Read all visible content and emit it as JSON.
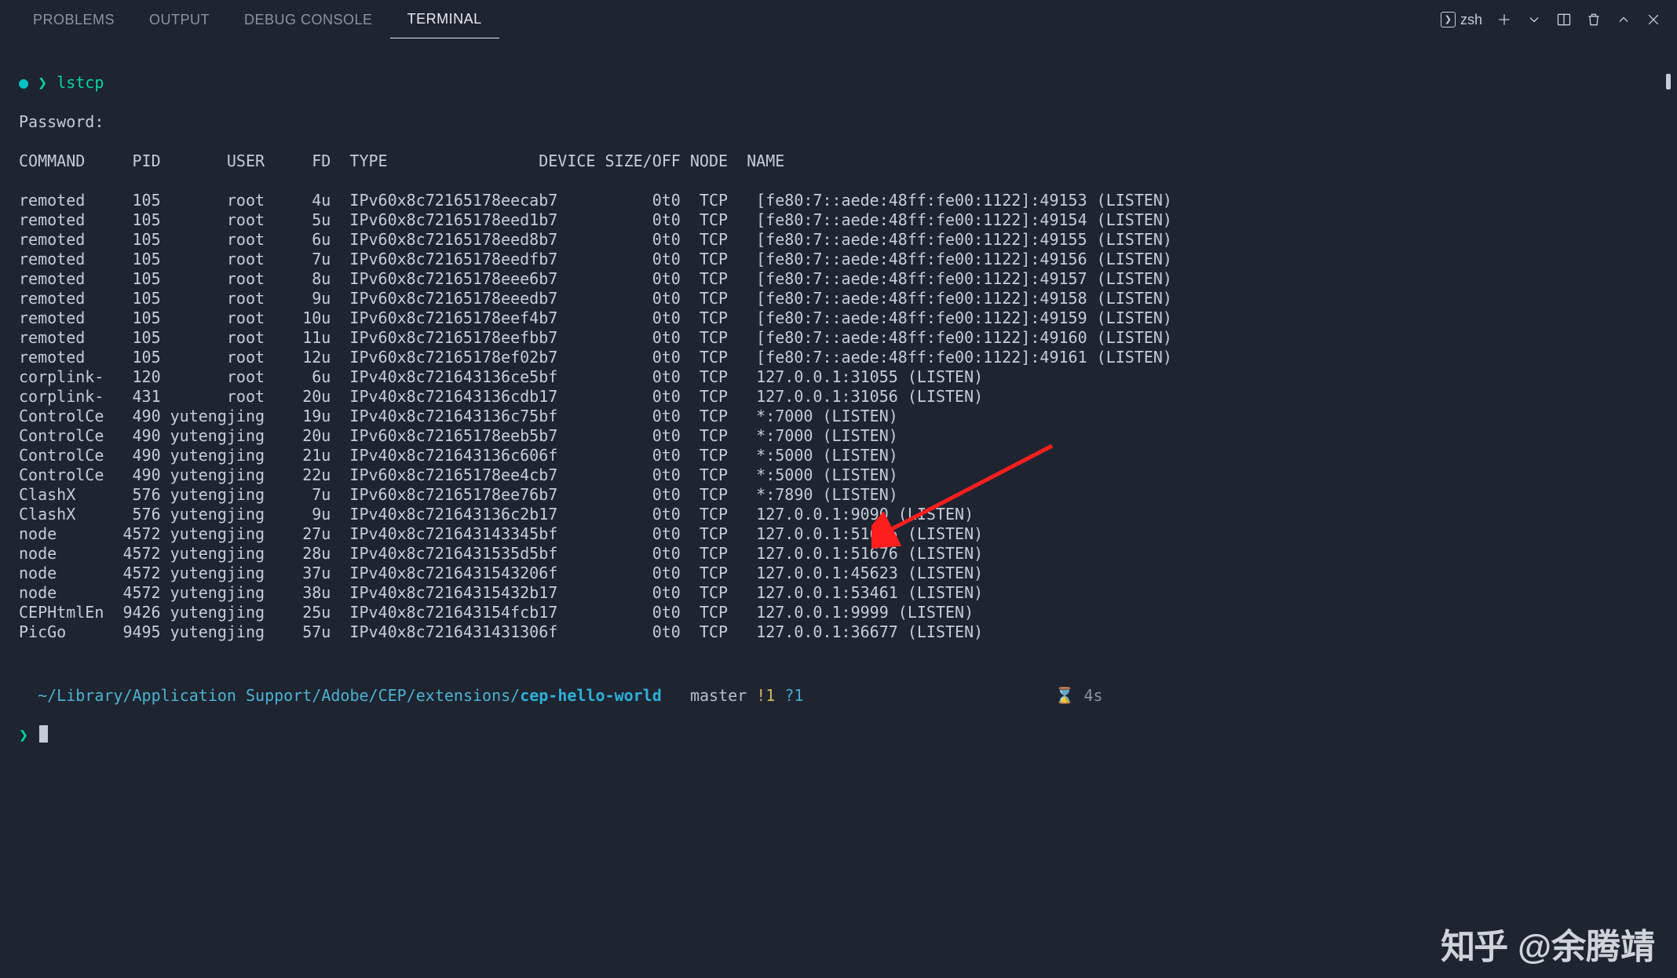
{
  "tabs": {
    "problems": "PROBLEMS",
    "output": "OUTPUT",
    "debug": "DEBUG CONSOLE",
    "terminal": "TERMINAL"
  },
  "actions": {
    "profile": "zsh"
  },
  "prompt": {
    "dot": "●",
    "arrow": "❯",
    "cmd": "lstcp",
    "password": "Password:"
  },
  "header": {
    "command": "COMMAND",
    "pid": "PID",
    "user": "USER",
    "fd": "FD",
    "type": "TYPE",
    "device": "DEVICE",
    "size": "SIZE/OFF",
    "node": "NODE",
    "name": "NAME"
  },
  "rows": [
    {
      "command": "remoted",
      "pid": "105",
      "user": "root",
      "fd": "4u",
      "type": "IPv6",
      "device": "0x8c72165178eecab7",
      "size": "0t0",
      "node": "TCP",
      "name": "[fe80:7::aede:48ff:fe00:1122]:49153 (LISTEN)"
    },
    {
      "command": "remoted",
      "pid": "105",
      "user": "root",
      "fd": "5u",
      "type": "IPv6",
      "device": "0x8c72165178eed1b7",
      "size": "0t0",
      "node": "TCP",
      "name": "[fe80:7::aede:48ff:fe00:1122]:49154 (LISTEN)"
    },
    {
      "command": "remoted",
      "pid": "105",
      "user": "root",
      "fd": "6u",
      "type": "IPv6",
      "device": "0x8c72165178eed8b7",
      "size": "0t0",
      "node": "TCP",
      "name": "[fe80:7::aede:48ff:fe00:1122]:49155 (LISTEN)"
    },
    {
      "command": "remoted",
      "pid": "105",
      "user": "root",
      "fd": "7u",
      "type": "IPv6",
      "device": "0x8c72165178eedfb7",
      "size": "0t0",
      "node": "TCP",
      "name": "[fe80:7::aede:48ff:fe00:1122]:49156 (LISTEN)"
    },
    {
      "command": "remoted",
      "pid": "105",
      "user": "root",
      "fd": "8u",
      "type": "IPv6",
      "device": "0x8c72165178eee6b7",
      "size": "0t0",
      "node": "TCP",
      "name": "[fe80:7::aede:48ff:fe00:1122]:49157 (LISTEN)"
    },
    {
      "command": "remoted",
      "pid": "105",
      "user": "root",
      "fd": "9u",
      "type": "IPv6",
      "device": "0x8c72165178eeedb7",
      "size": "0t0",
      "node": "TCP",
      "name": "[fe80:7::aede:48ff:fe00:1122]:49158 (LISTEN)"
    },
    {
      "command": "remoted",
      "pid": "105",
      "user": "root",
      "fd": "10u",
      "type": "IPv6",
      "device": "0x8c72165178eef4b7",
      "size": "0t0",
      "node": "TCP",
      "name": "[fe80:7::aede:48ff:fe00:1122]:49159 (LISTEN)"
    },
    {
      "command": "remoted",
      "pid": "105",
      "user": "root",
      "fd": "11u",
      "type": "IPv6",
      "device": "0x8c72165178eefbb7",
      "size": "0t0",
      "node": "TCP",
      "name": "[fe80:7::aede:48ff:fe00:1122]:49160 (LISTEN)"
    },
    {
      "command": "remoted",
      "pid": "105",
      "user": "root",
      "fd": "12u",
      "type": "IPv6",
      "device": "0x8c72165178ef02b7",
      "size": "0t0",
      "node": "TCP",
      "name": "[fe80:7::aede:48ff:fe00:1122]:49161 (LISTEN)"
    },
    {
      "command": "corplink-",
      "pid": "120",
      "user": "root",
      "fd": "6u",
      "type": "IPv4",
      "device": "0x8c721643136ce5bf",
      "size": "0t0",
      "node": "TCP",
      "name": "127.0.0.1:31055 (LISTEN)"
    },
    {
      "command": "corplink-",
      "pid": "431",
      "user": "root",
      "fd": "20u",
      "type": "IPv4",
      "device": "0x8c721643136cdb17",
      "size": "0t0",
      "node": "TCP",
      "name": "127.0.0.1:31056 (LISTEN)"
    },
    {
      "command": "ControlCe",
      "pid": "490",
      "user": "yutengjing",
      "fd": "19u",
      "type": "IPv4",
      "device": "0x8c721643136c75bf",
      "size": "0t0",
      "node": "TCP",
      "name": "*:7000 (LISTEN)"
    },
    {
      "command": "ControlCe",
      "pid": "490",
      "user": "yutengjing",
      "fd": "20u",
      "type": "IPv6",
      "device": "0x8c72165178eeb5b7",
      "size": "0t0",
      "node": "TCP",
      "name": "*:7000 (LISTEN)"
    },
    {
      "command": "ControlCe",
      "pid": "490",
      "user": "yutengjing",
      "fd": "21u",
      "type": "IPv4",
      "device": "0x8c721643136c606f",
      "size": "0t0",
      "node": "TCP",
      "name": "*:5000 (LISTEN)"
    },
    {
      "command": "ControlCe",
      "pid": "490",
      "user": "yutengjing",
      "fd": "22u",
      "type": "IPv6",
      "device": "0x8c72165178ee4cb7",
      "size": "0t0",
      "node": "TCP",
      "name": "*:5000 (LISTEN)"
    },
    {
      "command": "ClashX",
      "pid": "576",
      "user": "yutengjing",
      "fd": "7u",
      "type": "IPv6",
      "device": "0x8c72165178ee76b7",
      "size": "0t0",
      "node": "TCP",
      "name": "*:7890 (LISTEN)"
    },
    {
      "command": "ClashX",
      "pid": "576",
      "user": "yutengjing",
      "fd": "9u",
      "type": "IPv4",
      "device": "0x8c721643136c2b17",
      "size": "0t0",
      "node": "TCP",
      "name": "127.0.0.1:9090 (LISTEN)"
    },
    {
      "command": "node",
      "pid": "4572",
      "user": "yutengjing",
      "fd": "27u",
      "type": "IPv4",
      "device": "0x8c721643143345bf",
      "size": "0t0",
      "node": "TCP",
      "name": "127.0.0.1:51675 (LISTEN)"
    },
    {
      "command": "node",
      "pid": "4572",
      "user": "yutengjing",
      "fd": "28u",
      "type": "IPv4",
      "device": "0x8c7216431535d5bf",
      "size": "0t0",
      "node": "TCP",
      "name": "127.0.0.1:51676 (LISTEN)"
    },
    {
      "command": "node",
      "pid": "4572",
      "user": "yutengjing",
      "fd": "37u",
      "type": "IPv4",
      "device": "0x8c7216431543206f",
      "size": "0t0",
      "node": "TCP",
      "name": "127.0.0.1:45623 (LISTEN)"
    },
    {
      "command": "node",
      "pid": "4572",
      "user": "yutengjing",
      "fd": "38u",
      "type": "IPv4",
      "device": "0x8c72164315432b17",
      "size": "0t0",
      "node": "TCP",
      "name": "127.0.0.1:53461 (LISTEN)"
    },
    {
      "command": "CEPHtmlEn",
      "pid": "9426",
      "user": "yutengjing",
      "fd": "25u",
      "type": "IPv4",
      "device": "0x8c721643154fcb17",
      "size": "0t0",
      "node": "TCP",
      "name": "127.0.0.1:9999 (LISTEN)"
    },
    {
      "command": "PicGo",
      "pid": "9495",
      "user": "yutengjing",
      "fd": "57u",
      "type": "IPv4",
      "device": "0x8c72164314313 06f",
      "size": "0t0",
      "node": "TCP",
      "name": "127.0.0.1:36677 (LISTEN)"
    }
  ],
  "status": {
    "apple": "",
    "folder": "",
    "path_prefix": "~/Library/Application Support/Adobe/CEP/extensions/",
    "path_highlight": "cep-hello-world",
    "git_glyph": "",
    "branch_glyph": "",
    "branch": "master",
    "dirty": "!1",
    "untracked": "?1",
    "hourglass": "⌛",
    "timing": "4s"
  },
  "watermark": {
    "logo": "知乎",
    "author": "@余腾靖"
  }
}
